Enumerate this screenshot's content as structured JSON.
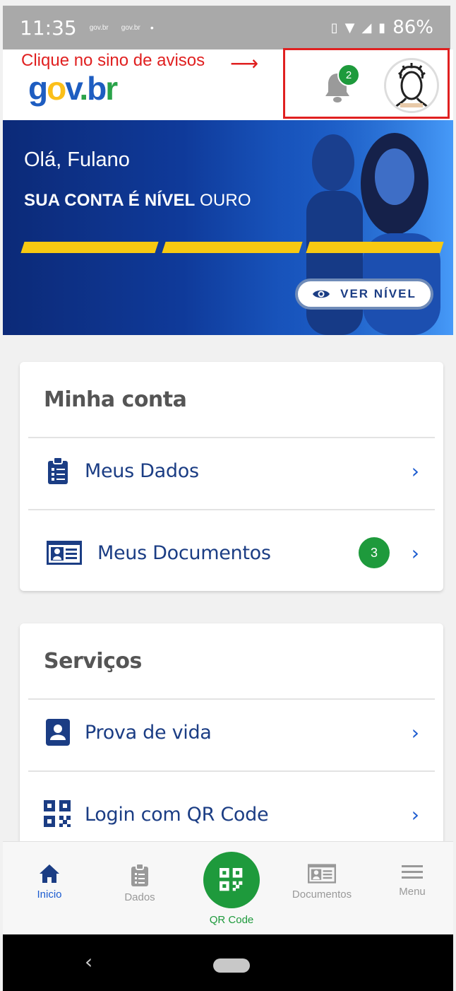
{
  "status_bar": {
    "time": "11:35",
    "notif_apps": [
      "gov.br",
      "gov.br"
    ],
    "battery": "86%"
  },
  "header": {
    "annotation": "Clique no sino de avisos",
    "annotation_arrow": "⟶",
    "logo": {
      "g": "g",
      "o": "o",
      "v": "v",
      "dot": ".",
      "b": "b",
      "r": "r"
    },
    "bell_badge": "2"
  },
  "banner": {
    "greeting": "Olá, Fulano",
    "level_prefix": "SUA CONTA É NÍVEL",
    "level_value": "OURO",
    "progress_filled": 3,
    "progress_total": 3,
    "ver_nivel": "VER NÍVEL"
  },
  "minha_conta": {
    "title": "Minha conta",
    "items": [
      {
        "label": "Meus Dados",
        "icon": "clipboard-list-icon"
      },
      {
        "label": "Meus Documentos",
        "icon": "id-card-icon",
        "count": "3"
      }
    ]
  },
  "servicos": {
    "title": "Serviços",
    "items": [
      {
        "label": "Prova de vida",
        "icon": "person-badge-icon"
      },
      {
        "label": "Login com QR Code",
        "icon": "qr-code-icon"
      }
    ]
  },
  "bottom_nav": {
    "items": [
      {
        "label": "Inicio",
        "icon": "home-icon"
      },
      {
        "label": "Dados",
        "icon": "clipboard-icon"
      },
      {
        "label": "QR Code",
        "icon": "qr-code-icon"
      },
      {
        "label": "Documentos",
        "icon": "id-card-icon"
      },
      {
        "label": "Menu",
        "icon": "menu-icon"
      }
    ]
  },
  "colors": {
    "primary_blue": "#1b3d84",
    "link_blue": "#1b5bd0",
    "green": "#1e9a3c",
    "gold": "#f7c912",
    "annotation_red": "#e02020"
  }
}
